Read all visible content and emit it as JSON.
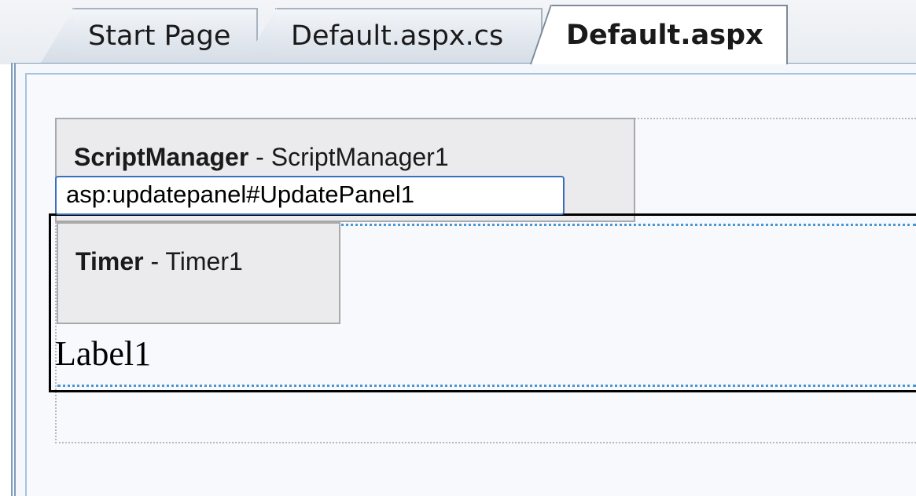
{
  "tabs": [
    {
      "label": "Start Page",
      "active": false
    },
    {
      "label": "Default.aspx.cs",
      "active": false
    },
    {
      "label": "Default.aspx",
      "active": true
    }
  ],
  "designer": {
    "script_manager": {
      "type": "ScriptManager",
      "separator": " - ",
      "id": "ScriptManager1"
    },
    "update_panel_tag": "asp:updatepanel#UpdatePanel1",
    "timer": {
      "type": "Timer",
      "separator": " - ",
      "id": "Timer1"
    },
    "label": "Label1"
  },
  "colors": {
    "selection_border": "#3a6fc0",
    "panel_dotted": "#4a97d6",
    "component_bg": "#ebebee",
    "surface_bg": "#f7f9fd"
  }
}
